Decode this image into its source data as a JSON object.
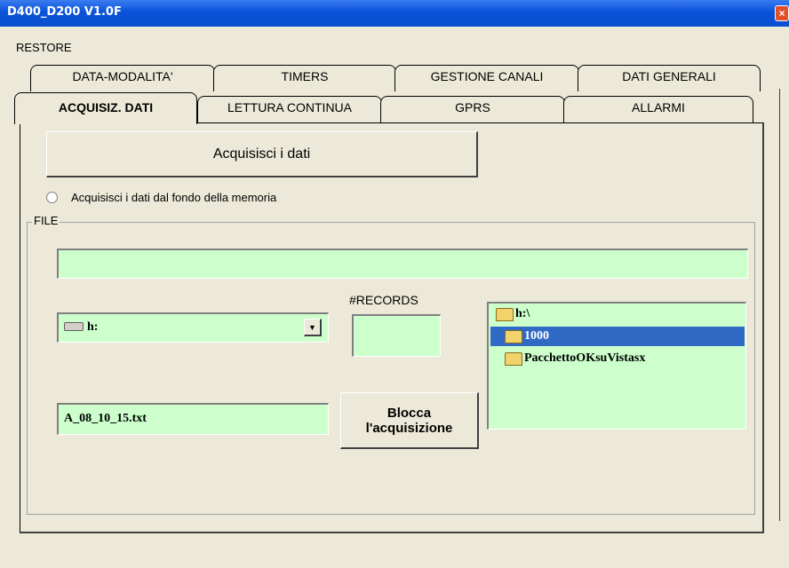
{
  "window": {
    "title": "D400_D200 V1.0F",
    "close_label": "×"
  },
  "menu": {
    "restore": "RESTORE"
  },
  "tabs_row_back": [
    {
      "label": "DATA-MODALITA'"
    },
    {
      "label": "TIMERS"
    },
    {
      "label": "GESTIONE CANALI"
    },
    {
      "label": "DATI GENERALI"
    }
  ],
  "tabs_row_front": [
    {
      "label": "ACQUISIZ. DATI",
      "selected": true
    },
    {
      "label": "LETTURA CONTINUA"
    },
    {
      "label": "GPRS"
    },
    {
      "label": "ALLARMI"
    }
  ],
  "acquire_button": "Acquisisci i dati",
  "memory_radio": {
    "label": "Acquisisci i dati dal fondo della memoria",
    "checked": false
  },
  "file_group": {
    "label": "FILE",
    "path_value": "",
    "drive": {
      "value": "h:",
      "icon": "drive-icon"
    },
    "records_label": "#RECORDS",
    "records_value": "",
    "filename_value": "A_08_10_15.txt",
    "stop_button": {
      "line1": "Blocca",
      "line2": "l'acquisizione"
    },
    "folders": [
      {
        "label": "h:\\",
        "icon": "open-folder-icon",
        "selected": false
      },
      {
        "label": "1000",
        "icon": "open-folder-icon",
        "selected": true
      },
      {
        "label": "PacchettoOKsuVistasx",
        "icon": "folder-icon",
        "selected": false
      }
    ]
  },
  "colors": {
    "field_bg": "#ccffcc",
    "selection": "#316ac5",
    "title_bar": "#0a53d8"
  }
}
